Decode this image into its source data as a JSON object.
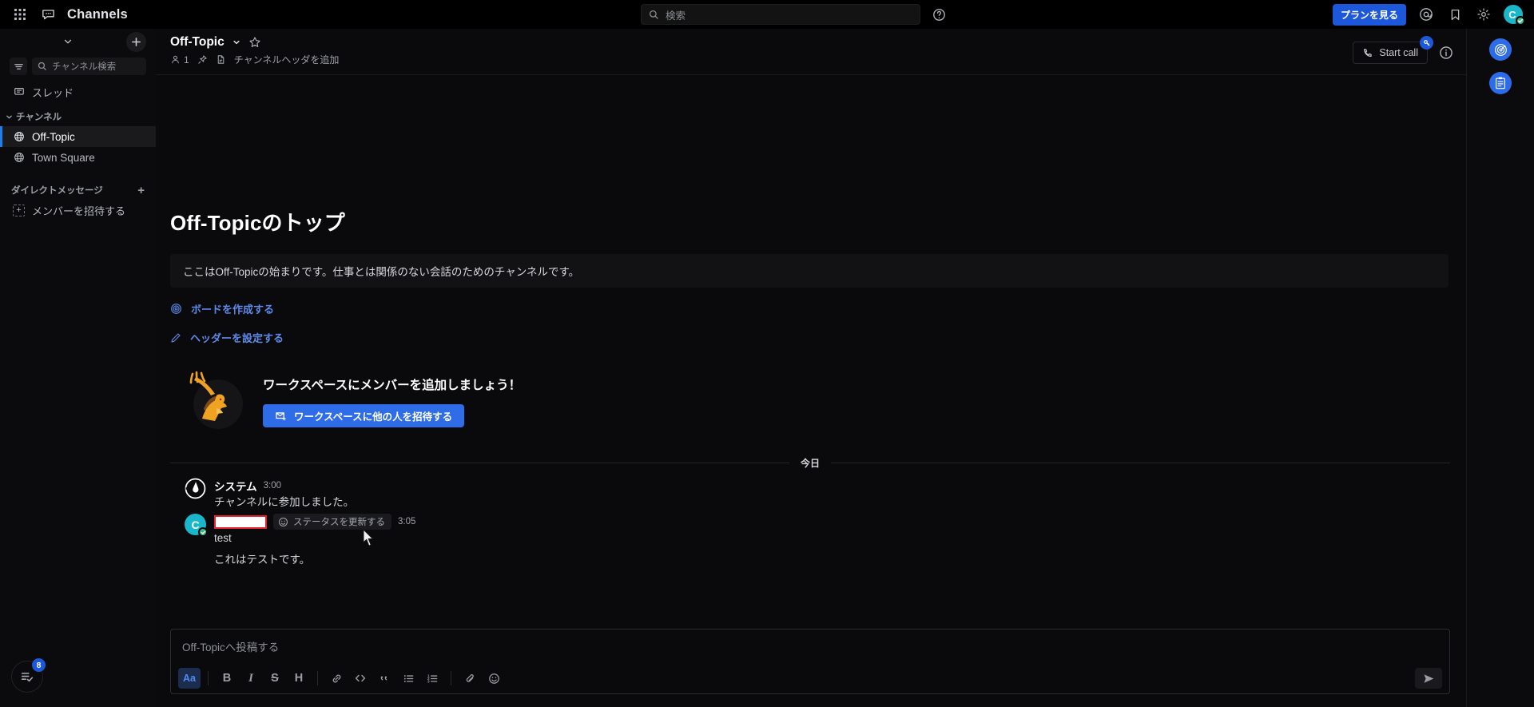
{
  "global_header": {
    "grid_icon": "apps-grid-icon",
    "product_icon": "channels-product-icon",
    "product_name": "Channels",
    "search": {
      "icon": "search-icon",
      "placeholder": "検索",
      "value": ""
    },
    "help_icon": "help-circle-icon",
    "plan_button": "プランを見る",
    "mention_icon": "at-mention-icon",
    "saved_icon": "bookmark-flag-icon",
    "settings_icon": "gear-icon",
    "avatar": {
      "initial": "C",
      "status": "online",
      "status_icon": "check-circle-icon"
    }
  },
  "sidebar": {
    "team_chevron_icon": "chevron-down-icon",
    "browse_add_icon": "plus-icon",
    "filter_icon": "filter-lines-icon",
    "search": {
      "icon": "search-icon",
      "placeholder": "チャンネル検索",
      "value": ""
    },
    "threads": {
      "icon": "threads-icon",
      "label": "スレッド"
    },
    "categories": [
      {
        "label": "チャンネル",
        "chevron_icon": "chevron-down-icon",
        "channels": [
          {
            "icon": "globe-icon",
            "label": "Off-Topic",
            "active": true
          },
          {
            "icon": "globe-icon",
            "label": "Town Square",
            "active": false
          }
        ]
      },
      {
        "label": "ダイレクトメッセージ",
        "add_icon": "plus-icon",
        "channels": []
      }
    ],
    "invite_members": {
      "icon": "add-member-icon",
      "label": "メンバーを招待する"
    },
    "tasks_button": {
      "icon": "checklist-icon",
      "badge": "8"
    }
  },
  "channel_header": {
    "title": "Off-Topic",
    "title_chevron_icon": "chevron-down-icon",
    "favorite_icon": "star-outline-icon",
    "members": {
      "icon": "member-icon",
      "count": "1"
    },
    "pinned_icon": "pin-icon",
    "files_icon": "file-icon",
    "header_placeholder": "チャンネルヘッダを追加",
    "start_call": {
      "icon": "phone-icon",
      "label": "Start call",
      "badge_icon": "key-icon"
    },
    "info_icon": "info-circle-icon"
  },
  "intro": {
    "title": "Off-Topicのトップ",
    "purpose": "ここはOff-Topicの始まりです。仕事とは関係のない会話のためのチャンネルです。",
    "links": [
      {
        "icon": "board-target-icon",
        "label": "ボードを作成する"
      },
      {
        "icon": "pencil-icon",
        "label": "ヘッダーを設定する"
      }
    ],
    "invite_panel": {
      "illustration": "person-waving-illustration",
      "heading": "ワークスペースにメンバーを追加しましょう！",
      "button": {
        "icon": "invite-mail-icon",
        "label": "ワークスペースに他の人を招待する"
      }
    }
  },
  "messages": {
    "date_divider": "今日",
    "posts": [
      {
        "avatar_icon": "mattermost-logo-icon",
        "author": "システム",
        "time": "3:00",
        "text": "チャンネルに参加しました。",
        "redacted": false
      },
      {
        "avatar_initial": "C",
        "author": "",
        "author_redacted": true,
        "status_chip": {
          "icon": "smiley-icon",
          "label": "ステータスを更新する"
        },
        "time": "3:05",
        "lines": [
          "test",
          "これはテストです。"
        ]
      }
    ]
  },
  "composer": {
    "placeholder": "Off-Topicへ投稿する",
    "value": "",
    "toolbar": [
      {
        "name": "formatting-toggle",
        "glyph": "Aa",
        "selected": true
      },
      {
        "name": "sep",
        "glyph": "|"
      },
      {
        "name": "bold",
        "glyph": "B",
        "selected": false
      },
      {
        "name": "italic",
        "glyph": "I",
        "selected": false
      },
      {
        "name": "strikethrough",
        "glyph": "S",
        "selected": false
      },
      {
        "name": "heading",
        "glyph": "H",
        "selected": false
      },
      {
        "name": "sep",
        "glyph": "|"
      },
      {
        "name": "link",
        "glyph": "link-icon",
        "selected": false
      },
      {
        "name": "code",
        "glyph": "code-icon",
        "selected": false
      },
      {
        "name": "quote",
        "glyph": "quote-icon",
        "selected": false
      },
      {
        "name": "bulleted-list",
        "glyph": "bullet-list-icon",
        "selected": false
      },
      {
        "name": "numbered-list",
        "glyph": "numbered-list-icon",
        "selected": false
      },
      {
        "name": "sep",
        "glyph": "|"
      },
      {
        "name": "attachment",
        "glyph": "paperclip-icon",
        "selected": false
      },
      {
        "name": "emoji",
        "glyph": "emoji-icon",
        "selected": false
      }
    ],
    "send_icon": "send-plane-icon"
  },
  "app_rail": {
    "items": [
      {
        "icon": "playbooks-target-icon",
        "name": "playbooks"
      },
      {
        "icon": "boards-clipboard-icon",
        "name": "boards"
      }
    ]
  },
  "colors": {
    "accent_blue": "#1c58d9",
    "link_blue": "#5d89e8",
    "active_indicator": "#1c7ff0",
    "avatar_teal": "#1ab7cb",
    "status_green": "#3db887",
    "redaction_border": "#e8222a",
    "sidebar_bg": "#0b0b0d",
    "center_bg": "#0a0a0c"
  }
}
